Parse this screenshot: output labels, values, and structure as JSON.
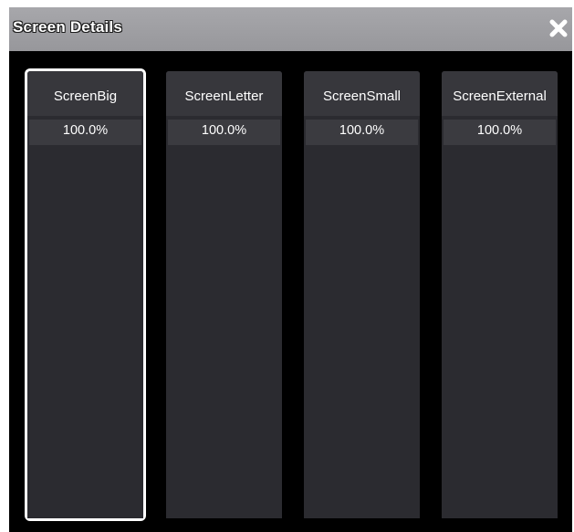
{
  "window": {
    "title": "Screen Details",
    "close_icon": "close-icon"
  },
  "screens": [
    {
      "name": "ScreenBig",
      "value": "100.0%",
      "selected": true
    },
    {
      "name": "ScreenLetter",
      "value": "100.0%",
      "selected": false
    },
    {
      "name": "ScreenSmall",
      "value": "100.0%",
      "selected": false
    },
    {
      "name": "ScreenExternal",
      "value": "100.0%",
      "selected": false
    }
  ],
  "colors": {
    "title_bar": "#9f9fa3",
    "panel": "#2b2b30",
    "header": "#37373c",
    "background": "#000000",
    "selection_outline": "#ffffff"
  }
}
